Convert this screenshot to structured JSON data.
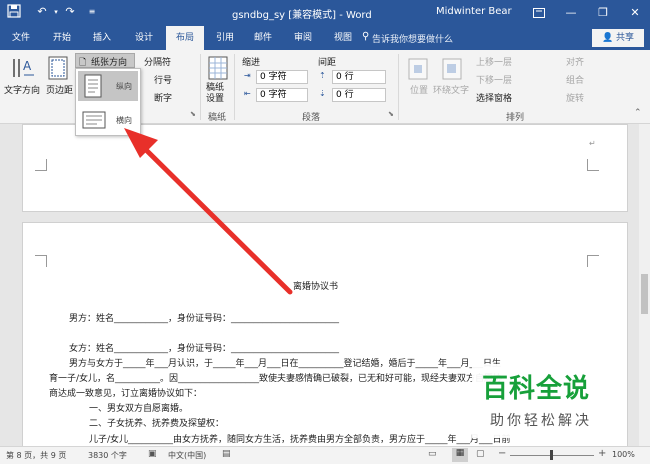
{
  "title_bar": {
    "doc_title": "gsndbg_sy [兼容模式] - Word",
    "user": "Midwinter Bear",
    "minimize": "—",
    "restore": "❐",
    "close": "✕"
  },
  "tabs": [
    "文件",
    "开始",
    "插入",
    "设计",
    "布局",
    "引用",
    "邮件",
    "审阅",
    "视图"
  ],
  "active_tab": "布局",
  "tell_me": "告诉我你想要做什么",
  "share": "共享",
  "ribbon": {
    "page_setup": {
      "text_direction": "文字方向",
      "margins": "页边距",
      "orientation": "纸张方向",
      "columns": "分隔符",
      "line_numbers": "行号",
      "hyphenation": "断字"
    },
    "draft": {
      "label": "稿纸设置",
      "group": "稿纸"
    },
    "paragraph": {
      "indent": "缩进",
      "spacing": "间距",
      "left_val": "0 字符",
      "right_val": "0 字符",
      "before_val": "0 行",
      "after_val": "0 行",
      "group": "段落"
    },
    "arrange": {
      "position": "位置",
      "wrap": "环绕文字",
      "forward": "上移一层",
      "backward": "下移一层",
      "selection_pane": "选择窗格",
      "align": "对齐",
      "group_btn": "组合",
      "rotate": "旋转",
      "group": "排列"
    }
  },
  "orientation_menu": {
    "portrait": "纵向",
    "landscape": "横向"
  },
  "document": {
    "title": "离婚协议书",
    "lines": [
      "男方：姓名____________，身份证号码：________________________",
      "女方：姓名____________，身份证号码：________________________",
      "男方与女方于_____年___月认识，于_____年___月___日在__________登记结婚，婚后于_____年___月___日生",
      "育一子/女儿，名__________。因__________________致使夫妻感情确已破裂，已无和好可能，现经夫妻双方自愿协",
      "商达成一致意见，订立离婚协议如下：",
      "一、男女双方自愿离婚。",
      "二、子女抚养、抚养费及探望权：",
      "儿子/女儿__________由女方抚养，随同女方生活，抚养费由男方全部负责，男方应于_____年___月___日前"
    ]
  },
  "status_bar": {
    "page": "第 8 页，共 9 页",
    "words": "3830 个字",
    "language": "中文(中国)",
    "zoom": "100%"
  },
  "watermark": {
    "big": "百科全说",
    "small": "助你轻松解决"
  }
}
